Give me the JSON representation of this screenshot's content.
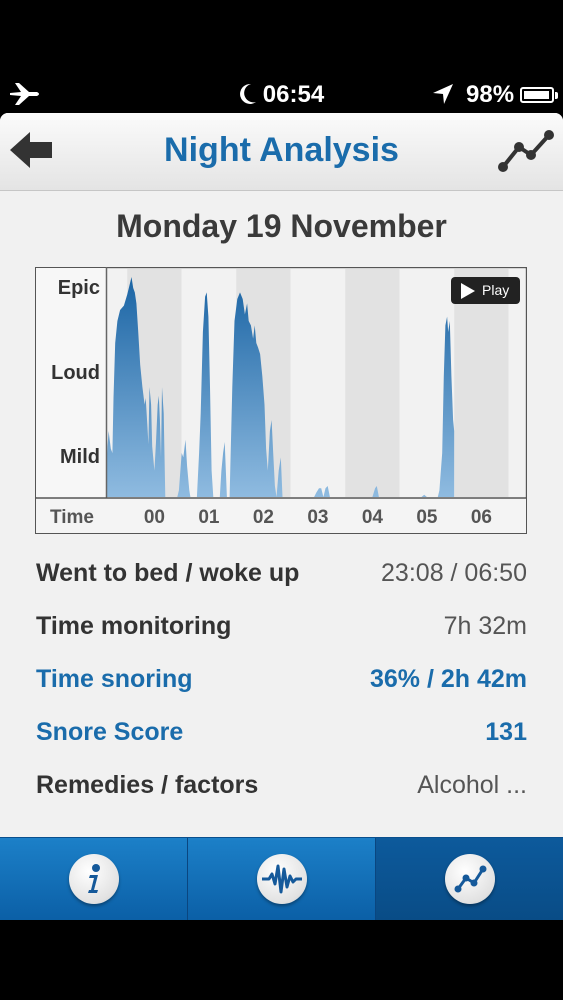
{
  "status_bar": {
    "time": "06:54",
    "battery_percent": "98%",
    "battery_level": 0.98
  },
  "nav": {
    "title": "Night Analysis"
  },
  "date": "Monday 19 November",
  "chart_data": {
    "type": "area",
    "y_levels": [
      "Epic",
      "Loud",
      "Mild"
    ],
    "x_label": "Time",
    "x_ticks": [
      "00",
      "01",
      "02",
      "03",
      "04",
      "05",
      "06"
    ],
    "x_range": [
      -0.87,
      6.8
    ],
    "y_range": [
      0,
      1
    ],
    "color": "#1b6fae",
    "play_label": "Play",
    "series": [
      {
        "values": [
          [
            -0.87,
            0.2
          ],
          [
            -0.84,
            0.3
          ],
          [
            -0.8,
            0.22
          ],
          [
            -0.77,
            0.2
          ],
          [
            -0.75,
            0.45
          ],
          [
            -0.72,
            0.7
          ],
          [
            -0.68,
            0.8
          ],
          [
            -0.63,
            0.85
          ],
          [
            -0.56,
            0.87
          ],
          [
            -0.5,
            0.92
          ],
          [
            -0.45,
            0.97
          ],
          [
            -0.42,
            1.0
          ],
          [
            -0.39,
            0.95
          ],
          [
            -0.36,
            0.93
          ],
          [
            -0.33,
            0.88
          ],
          [
            -0.3,
            0.76
          ],
          [
            -0.26,
            0.6
          ],
          [
            -0.22,
            0.5
          ],
          [
            -0.18,
            0.42
          ],
          [
            -0.16,
            0.45
          ],
          [
            -0.13,
            0.33
          ],
          [
            -0.11,
            0.24
          ],
          [
            -0.09,
            0.5
          ],
          [
            -0.06,
            0.42
          ],
          [
            -0.04,
            0.23
          ],
          [
            0.0,
            0.12
          ],
          [
            0.03,
            0.25
          ],
          [
            0.06,
            0.42
          ],
          [
            0.08,
            0.46
          ],
          [
            0.1,
            0.35
          ],
          [
            0.12,
            0.18
          ],
          [
            0.14,
            0.5
          ],
          [
            0.17,
            0.38
          ],
          [
            0.2,
            0.0
          ],
          [
            0.3,
            0.0
          ],
          [
            0.38,
            0.0
          ],
          [
            0.42,
            0.0
          ],
          [
            0.45,
            0.03
          ],
          [
            0.5,
            0.2
          ],
          [
            0.53,
            0.18
          ],
          [
            0.57,
            0.26
          ],
          [
            0.6,
            0.14
          ],
          [
            0.64,
            0.03
          ],
          [
            0.66,
            0.0
          ],
          [
            0.78,
            0.0
          ],
          [
            0.82,
            0.2
          ],
          [
            0.85,
            0.38
          ],
          [
            0.89,
            0.75
          ],
          [
            0.93,
            0.91
          ],
          [
            0.96,
            0.93
          ],
          [
            0.99,
            0.82
          ],
          [
            1.02,
            0.5
          ],
          [
            1.05,
            0.12
          ],
          [
            1.08,
            0.0
          ],
          [
            1.15,
            0.0
          ],
          [
            1.2,
            0.0
          ],
          [
            1.23,
            0.12
          ],
          [
            1.26,
            0.2
          ],
          [
            1.29,
            0.25
          ],
          [
            1.33,
            0.0
          ],
          [
            1.38,
            0.0
          ],
          [
            1.43,
            0.5
          ],
          [
            1.47,
            0.8
          ],
          [
            1.52,
            0.9
          ],
          [
            1.57,
            0.93
          ],
          [
            1.62,
            0.9
          ],
          [
            1.66,
            0.83
          ],
          [
            1.7,
            0.88
          ],
          [
            1.73,
            0.8
          ],
          [
            1.77,
            0.78
          ],
          [
            1.81,
            0.72
          ],
          [
            1.84,
            0.78
          ],
          [
            1.87,
            0.7
          ],
          [
            1.9,
            0.68
          ],
          [
            1.94,
            0.65
          ],
          [
            1.98,
            0.55
          ],
          [
            2.02,
            0.42
          ],
          [
            2.05,
            0.22
          ],
          [
            2.08,
            0.12
          ],
          [
            2.12,
            0.3
          ],
          [
            2.15,
            0.35
          ],
          [
            2.18,
            0.2
          ],
          [
            2.21,
            0.05
          ],
          [
            2.24,
            0.0
          ],
          [
            2.28,
            0.12
          ],
          [
            2.32,
            0.18
          ],
          [
            2.35,
            0.0
          ],
          [
            2.7,
            0.0
          ],
          [
            2.93,
            0.0
          ],
          [
            2.97,
            0.02
          ],
          [
            3.02,
            0.04
          ],
          [
            3.06,
            0.04
          ],
          [
            3.1,
            0.0
          ],
          [
            3.14,
            0.04
          ],
          [
            3.18,
            0.05
          ],
          [
            3.22,
            0.0
          ],
          [
            4.0,
            0.0
          ],
          [
            4.05,
            0.04
          ],
          [
            4.08,
            0.05
          ],
          [
            4.12,
            0.0
          ],
          [
            4.9,
            0.0
          ],
          [
            4.95,
            0.01
          ],
          [
            5.0,
            0.0
          ],
          [
            5.1,
            0.0
          ],
          [
            5.2,
            0.0
          ],
          [
            5.23,
            0.03
          ],
          [
            5.28,
            0.2
          ],
          [
            5.31,
            0.55
          ],
          [
            5.34,
            0.78
          ],
          [
            5.37,
            0.82
          ],
          [
            5.39,
            0.75
          ],
          [
            5.42,
            0.8
          ],
          [
            5.45,
            0.55
          ],
          [
            5.48,
            0.35
          ],
          [
            5.5,
            0.3
          ]
        ]
      }
    ]
  },
  "stats": {
    "bed": {
      "label": "Went to bed / woke up",
      "value": "23:08 / 06:50"
    },
    "monitoring": {
      "label": "Time monitoring",
      "value": "7h 32m"
    },
    "snoring": {
      "label": "Time snoring",
      "value": "36% / 2h 42m"
    },
    "score": {
      "label": "Snore Score",
      "value": "131"
    },
    "remedies": {
      "label": "Remedies / factors",
      "value": "Alcohol ..."
    }
  },
  "tabs": [
    {
      "icon": "info-icon",
      "active": false
    },
    {
      "icon": "waveform-icon",
      "active": false
    },
    {
      "icon": "trend-chart-icon",
      "active": true
    }
  ],
  "colors": {
    "accent": "#1a6cab",
    "tabbar": "#0b5fa6"
  }
}
